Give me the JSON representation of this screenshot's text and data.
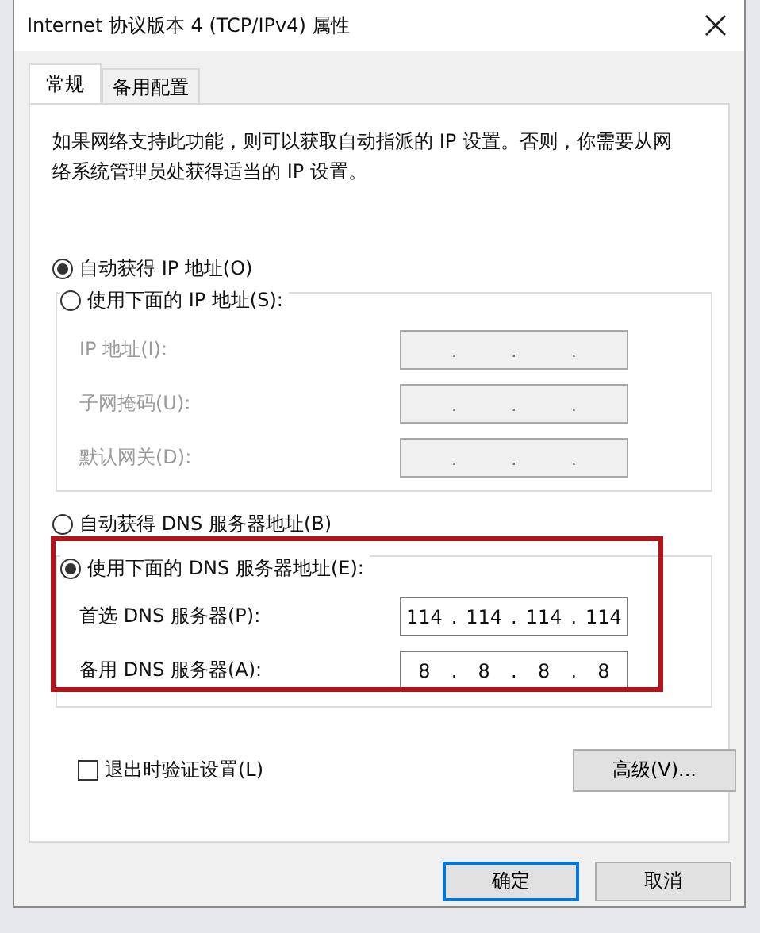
{
  "window": {
    "title": "Internet 协议版本 4 (TCP/IPv4) 属性"
  },
  "tabs": [
    {
      "label": "常规",
      "selected": true
    },
    {
      "label": "备用配置",
      "selected": false
    }
  ],
  "description": "如果网络支持此功能，则可以获取自动指派的 IP 设置。否则，你需要从网络系统管理员处获得适当的 IP 设置。",
  "separator": ".",
  "ip_options": [
    {
      "label": "自动获得 IP 地址(O)",
      "selected": true
    },
    {
      "label": "使用下面的 IP 地址(S):",
      "selected": false
    }
  ],
  "ip_fields": [
    {
      "label": "IP 地址(I):",
      "disabled": true
    },
    {
      "label": "子网掩码(U):",
      "disabled": true
    },
    {
      "label": "默认网关(D):",
      "disabled": true
    }
  ],
  "dns_options": [
    {
      "label": "自动获得 DNS 服务器地址(B)",
      "selected": false
    },
    {
      "label": "使用下面的 DNS 服务器地址(E):",
      "selected": true
    }
  ],
  "dns_fields": [
    {
      "label": "首选 DNS 服务器(P):",
      "disabled": false,
      "octets": [
        "114",
        "114",
        "114",
        "114"
      ]
    },
    {
      "label": "备用 DNS 服务器(A):",
      "disabled": false,
      "octets": [
        "8",
        "8",
        "8",
        "8"
      ]
    }
  ],
  "validate": {
    "label": "退出时验证设置(L)",
    "checked": false
  },
  "advanced_button": "高级(V)...",
  "buttons": [
    {
      "label": "确定",
      "default": true
    },
    {
      "label": "取消",
      "default": false
    }
  ]
}
